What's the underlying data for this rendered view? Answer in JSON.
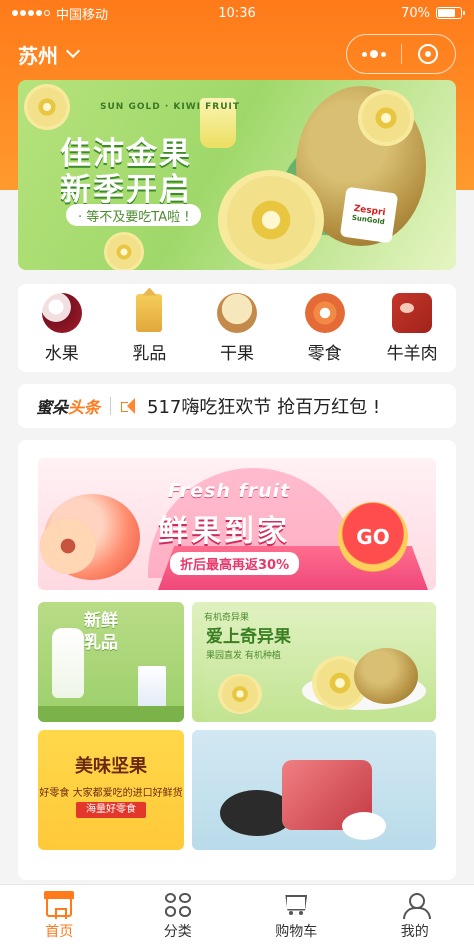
{
  "status_bar": {
    "carrier": "中国移动",
    "time": "10:36",
    "battery": "70%"
  },
  "header": {
    "city": "苏州"
  },
  "banner": {
    "brand_small": "SUN GOLD · KIWI FRUIT",
    "title_line1": "佳沛金果",
    "title_line2": "新季开启",
    "pill": "· 等不及要吃TA啦 !",
    "logo_main": "Zespri",
    "logo_sub": "SunGold"
  },
  "categories": [
    {
      "label": "水果",
      "icon": "lychee-icon"
    },
    {
      "label": "乳品",
      "icon": "milk-carton-icon"
    },
    {
      "label": "干果",
      "icon": "nut-icon"
    },
    {
      "label": "零食",
      "icon": "donut-icon"
    },
    {
      "label": "牛羊肉",
      "icon": "meat-icon"
    }
  ],
  "news": {
    "brand_part1": "蜜朵",
    "brand_part2": "头条",
    "text": "517嗨吃狂欢节 抢百万红包 !"
  },
  "promo": {
    "fresh_en": "Fresh fruit",
    "fresh_cn": "鲜果到家",
    "fresh_sub": "折后最高再返30%",
    "go_label": "GO",
    "tile_dairy_title": "新鲜\n乳品",
    "tile_kiwi_label": "有机奇异果",
    "tile_kiwi_title": "爱上奇异果",
    "tile_kiwi_sub": "果园直发 有机种植",
    "tile_nuts_title": "美味坚果",
    "tile_nuts_sub": "好零食 大家都爱吃的进口好鲜货",
    "tile_nuts_badge": "海量好零食"
  },
  "tabbar": [
    {
      "label": "首页",
      "icon": "home-store-icon",
      "active": true
    },
    {
      "label": "分类",
      "icon": "category-grid-icon",
      "active": false
    },
    {
      "label": "购物车",
      "icon": "cart-icon",
      "active": false
    },
    {
      "label": "我的",
      "icon": "user-icon",
      "active": false
    }
  ],
  "colors": {
    "accent": "#ff7a1a",
    "banner_green": "#9fd86a",
    "promo_pink": "#ff5c8a"
  }
}
